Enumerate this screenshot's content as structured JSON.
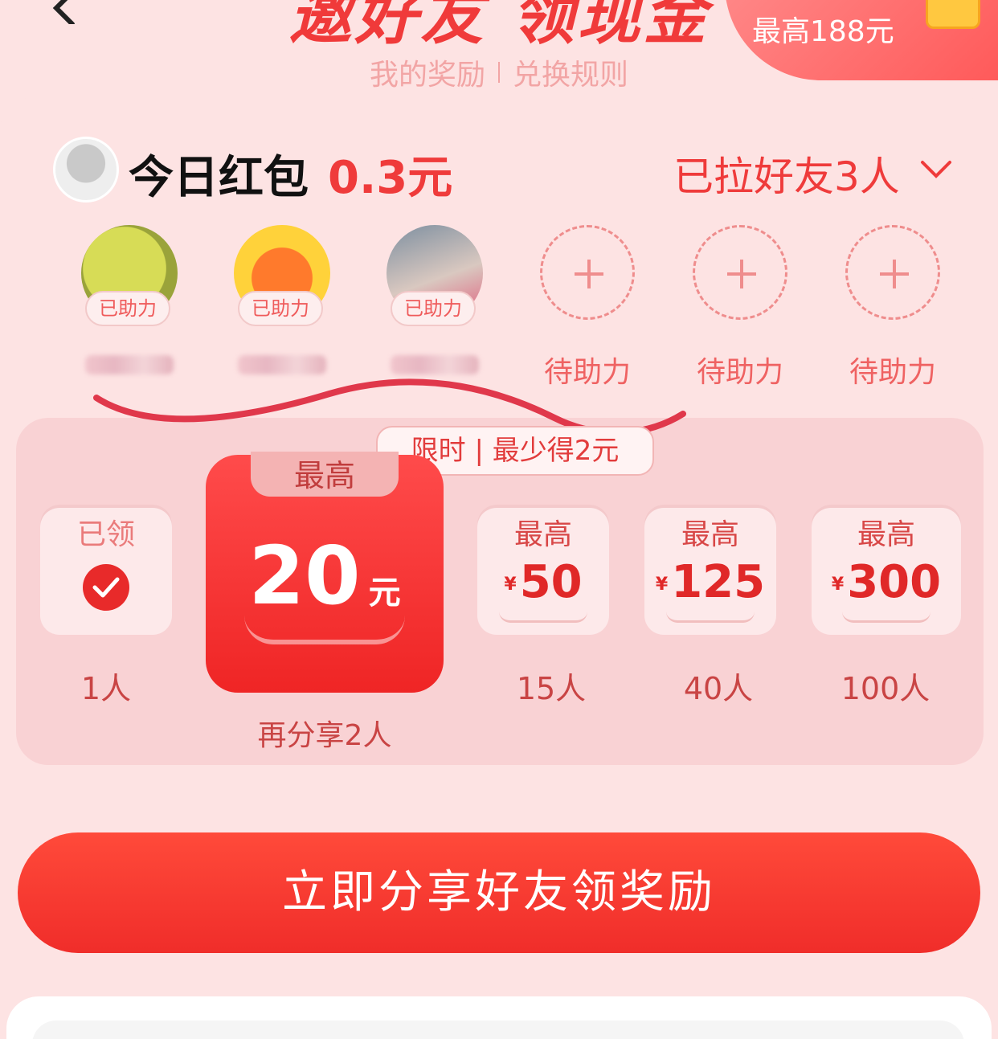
{
  "header": {
    "title": "邀好友 领现金",
    "links": [
      "我的奖励",
      "兑换规则"
    ],
    "corner_badge": "最高188元"
  },
  "summary": {
    "today_label": "今日红包",
    "today_amount": "0.3元",
    "invited_text": "已拉好友3人"
  },
  "friends": [
    {
      "status": "已助力"
    },
    {
      "status": "已助力"
    },
    {
      "status": "已助力"
    },
    {
      "status": "待助力"
    },
    {
      "status": "待助力"
    },
    {
      "status": "待助力"
    }
  ],
  "rewards": {
    "limited_tag": "限时 | 最少得2元",
    "tiers": [
      {
        "title": "已领",
        "count": "1人"
      },
      {
        "title": "最高",
        "value": "20",
        "unit": "元",
        "note": "再分享2人"
      },
      {
        "title": "最高",
        "currency": "¥",
        "value": "50",
        "count": "15人"
      },
      {
        "title": "最高",
        "currency": "¥",
        "value": "125",
        "count": "40人"
      },
      {
        "title": "最高",
        "currency": "¥",
        "value": "300",
        "count": "100人"
      }
    ]
  },
  "cta": {
    "label": "立即分享好友领奖励"
  },
  "colors": {
    "accent": "#ef3b3b",
    "background": "#fde3e3",
    "button": "#f02d2a"
  },
  "icons": [
    "back-arrow-icon",
    "chevron-down-icon",
    "check-icon",
    "plus-icon",
    "coin-icon"
  ]
}
